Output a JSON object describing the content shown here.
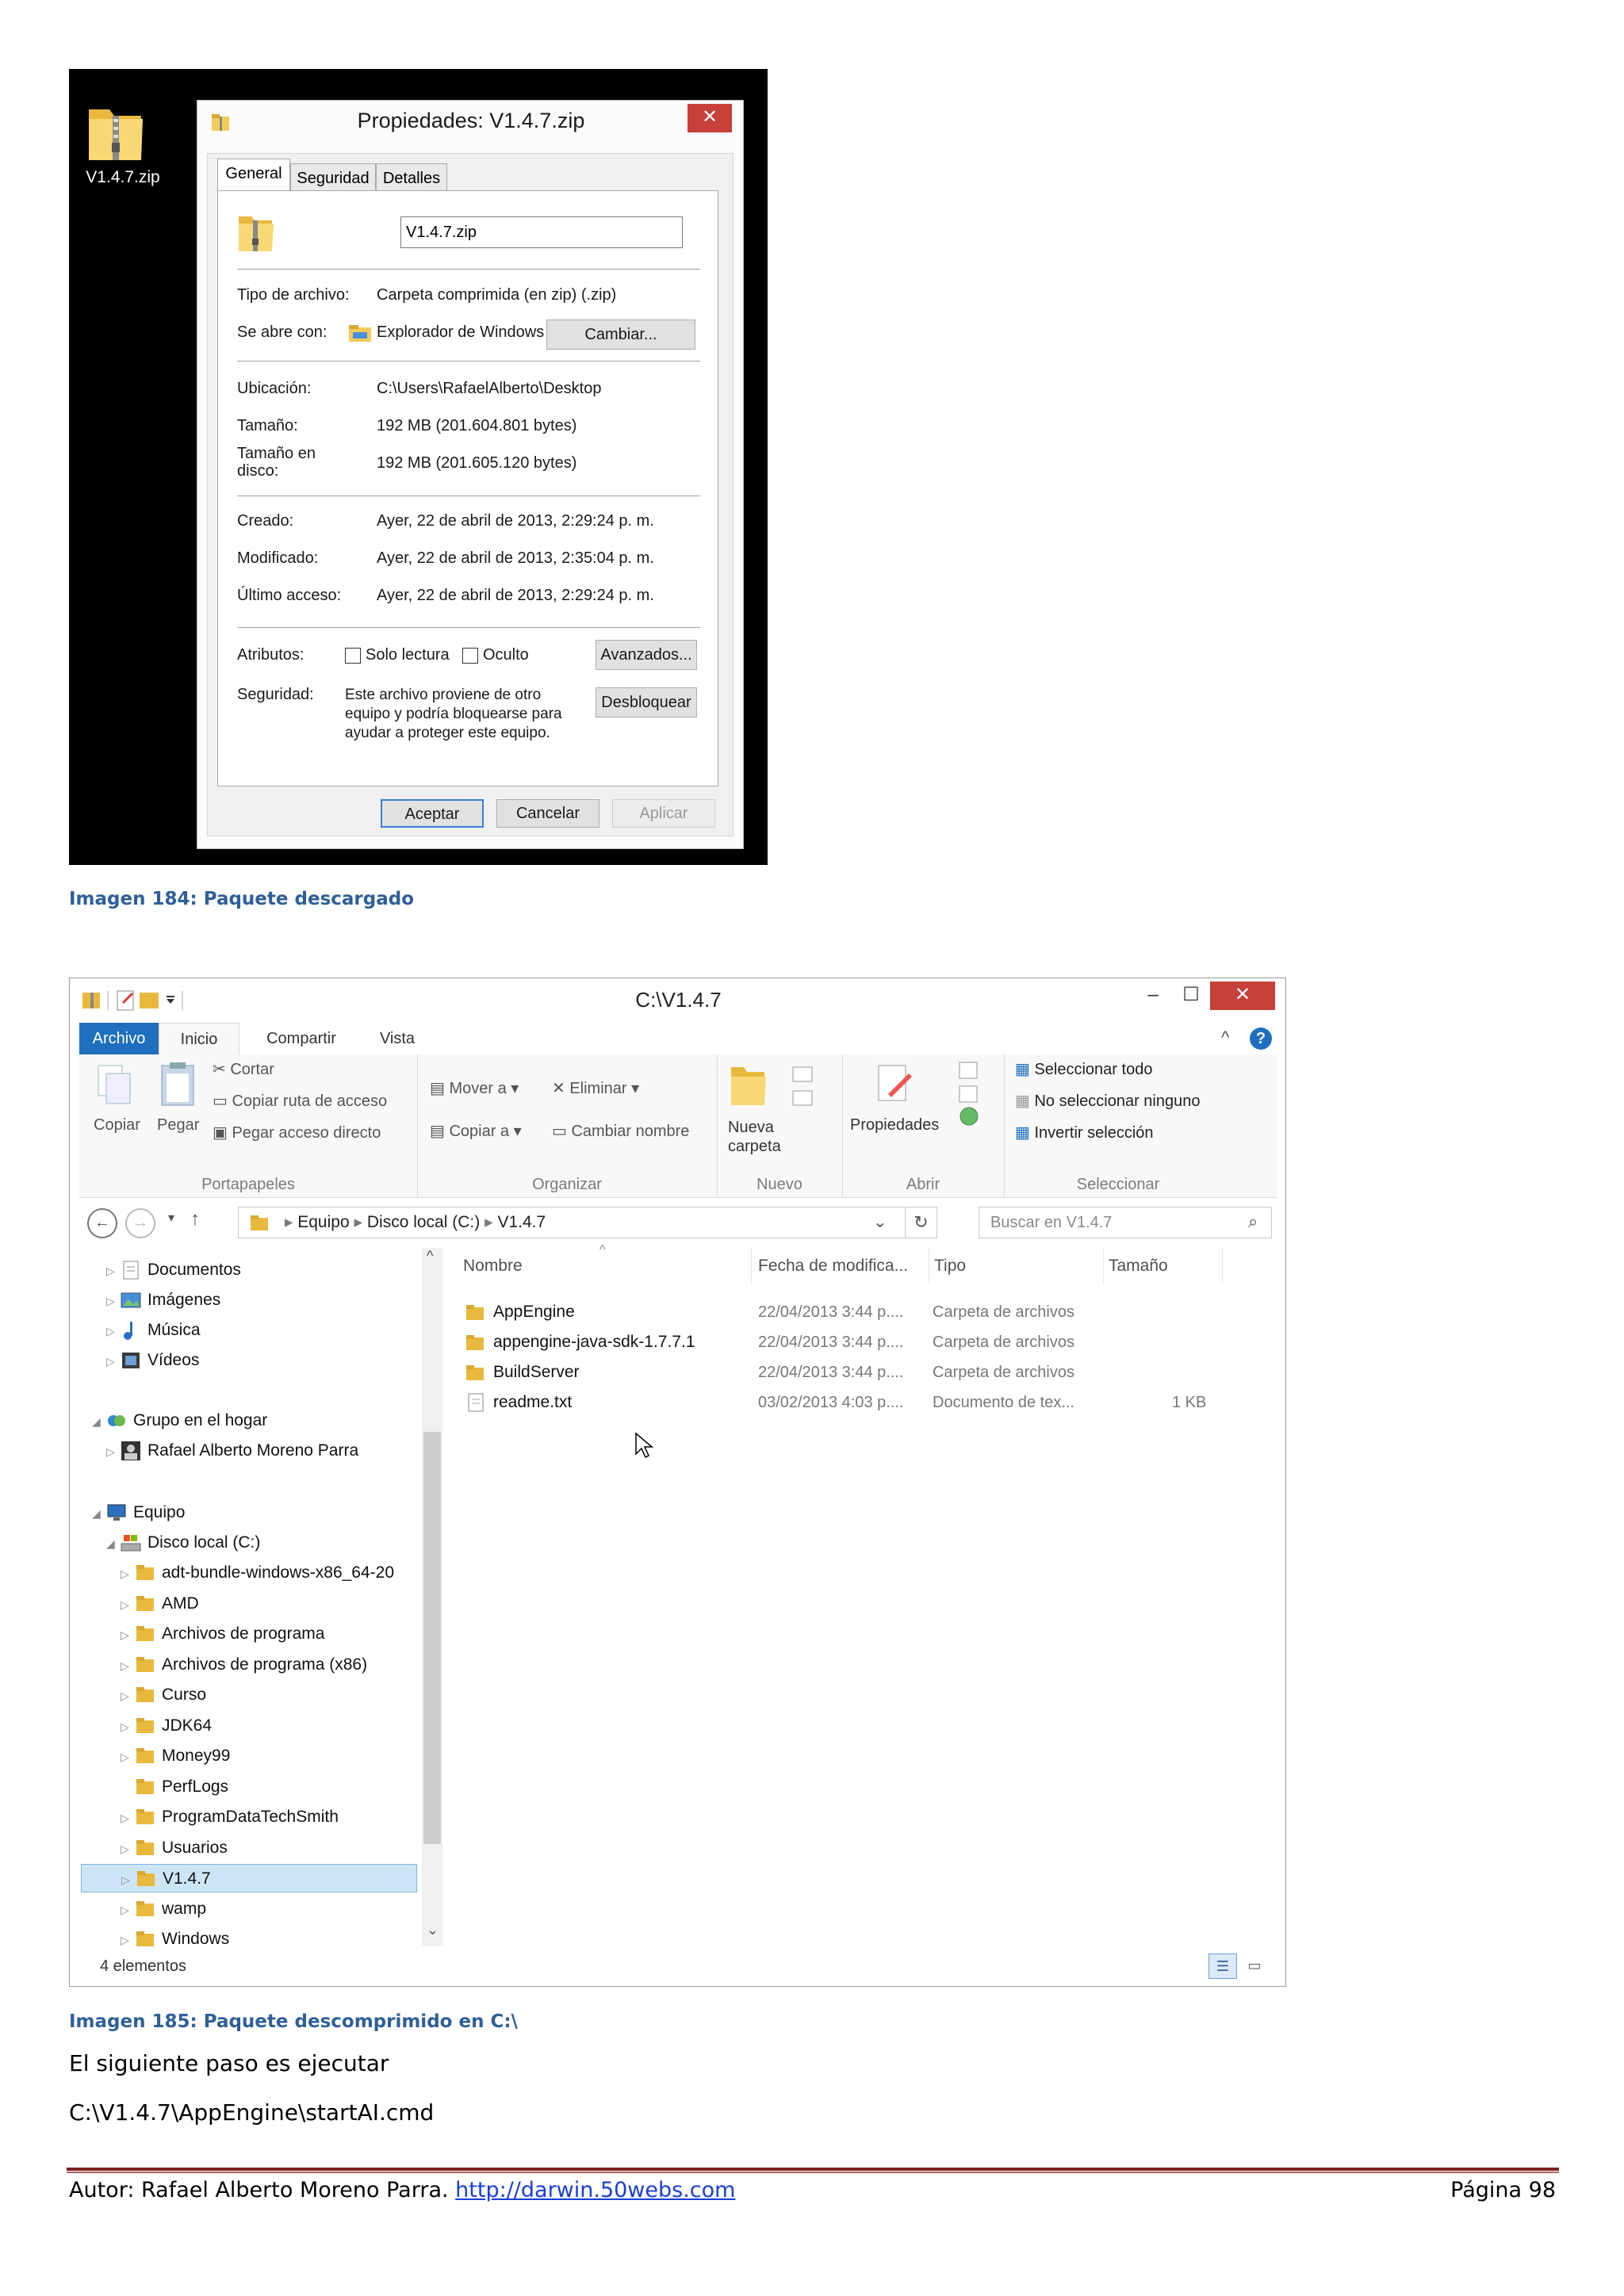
{
  "figure1": {
    "desktop_icon_label": "V1.4.7.zip",
    "dialog": {
      "title": "Propiedades: V1.4.7.zip",
      "close": "✕",
      "tabs": [
        "General",
        "Seguridad",
        "Detalles"
      ],
      "filename": "V1.4.7.zip",
      "tipo_label": "Tipo de archivo:",
      "tipo_value": "Carpeta comprimida (en zip) (.zip)",
      "abre_label": "Se abre con:",
      "abre_value": "Explorador de Windows",
      "cambiar": "Cambiar...",
      "ubicacion_label": "Ubicación:",
      "ubicacion_value": "C:\\Users\\RafaelAlberto\\Desktop",
      "tamano_label": "Tamaño:",
      "tamano_value": "192 MB (201.604.801 bytes)",
      "tamano_disco_label_1": "Tamaño en",
      "tamano_disco_label_2": "disco:",
      "tamano_disco_value": "192 MB (201.605.120 bytes)",
      "creado_label": "Creado:",
      "creado_value": "Ayer, 22 de abril de 2013, 2:29:24 p. m.",
      "modificado_label": "Modificado:",
      "modificado_value": "Ayer, 22 de abril de 2013, 2:35:04 p. m.",
      "acceso_label": "Último acceso:",
      "acceso_value": "Ayer, 22 de abril de 2013, 2:29:24 p. m.",
      "atributos_label": "Atributos:",
      "solo_lectura": "Solo lectura",
      "oculto": "Oculto",
      "avanzados": "Avanzados...",
      "seguridad_label": "Seguridad:",
      "seguridad_text_1": "Este archivo proviene de otro",
      "seguridad_text_2": "equipo y podría bloquearse para",
      "seguridad_text_3": "ayudar a proteger este equipo.",
      "desbloquear": "Desbloquear",
      "aceptar": "Aceptar",
      "cancelar": "Cancelar",
      "aplicar": "Aplicar"
    },
    "caption": "Imagen 184: Paquete descargado"
  },
  "figure2": {
    "window_title": "C:\\V1.4.7",
    "ribbon_tabs": [
      "Archivo",
      "Inicio",
      "Compartir",
      "Vista"
    ],
    "portapapeles": {
      "copiar": "Copiar",
      "pegar": "Pegar",
      "cortar": "Cortar",
      "copiar_ruta": "Copiar ruta de acceso",
      "pegar_acceso": "Pegar acceso directo",
      "name": "Portapapeles"
    },
    "organizar": {
      "mover": "Mover a",
      "copiar_a": "Copiar a",
      "eliminar": "Eliminar",
      "cambiar_nombre": "Cambiar nombre",
      "name": "Organizar"
    },
    "nuevo": {
      "nueva_1": "Nueva",
      "nueva_2": "carpeta",
      "name": "Nuevo"
    },
    "abrir": {
      "propiedades": "Propiedades",
      "name": "Abrir"
    },
    "seleccionar": {
      "todo": "Seleccionar todo",
      "ninguno": "No seleccionar ninguno",
      "invertir": "Invertir selección",
      "name": "Seleccionar"
    },
    "address": {
      "crumbs": [
        "Equipo",
        "Disco local (C:)",
        "V1.4.7"
      ]
    },
    "search_placeholder": "Buscar en V1.4.7",
    "nav": [
      {
        "label": "Documentos"
      },
      {
        "label": "Imágenes"
      },
      {
        "label": "Música"
      },
      {
        "label": "Vídeos"
      },
      {
        "label": "Grupo en el hogar"
      },
      {
        "label": "Rafael Alberto Moreno Parra"
      },
      {
        "label": "Equipo"
      },
      {
        "label": "Disco local (C:)"
      },
      {
        "label": "adt-bundle-windows-x86_64-20"
      },
      {
        "label": "AMD"
      },
      {
        "label": "Archivos de programa"
      },
      {
        "label": "Archivos de programa (x86)"
      },
      {
        "label": "Curso"
      },
      {
        "label": "JDK64"
      },
      {
        "label": "Money99"
      },
      {
        "label": "PerfLogs"
      },
      {
        "label": "ProgramDataTechSmith"
      },
      {
        "label": "Usuarios"
      },
      {
        "label": "V1.4.7"
      },
      {
        "label": "wamp"
      },
      {
        "label": "Windows"
      }
    ],
    "columns": [
      "Nombre",
      "Fecha de modifica...",
      "Tipo",
      "Tamaño"
    ],
    "files": [
      {
        "name": "AppEngine",
        "date": "22/04/2013 3:44 p....",
        "type": "Carpeta de archivos",
        "size": ""
      },
      {
        "name": "appengine-java-sdk-1.7.7.1",
        "date": "22/04/2013 3:44 p....",
        "type": "Carpeta de archivos",
        "size": ""
      },
      {
        "name": "BuildServer",
        "date": "22/04/2013 3:44 p....",
        "type": "Carpeta de archivos",
        "size": ""
      },
      {
        "name": "readme.txt",
        "date": "03/02/2013 4:03 p....",
        "type": "Documento de tex...",
        "size": "1 KB"
      }
    ],
    "status": "4 elementos",
    "caption": "Imagen 185: Paquete descomprimido en C:\\"
  },
  "body": {
    "line1": "El siguiente paso es ejecutar",
    "line2": "C:\\V1.4.7\\AppEngine\\startAI.cmd"
  },
  "footer": {
    "author": "Autor: Rafael Alberto Moreno Parra.",
    "link": "http://darwin.50webs.com",
    "page": "Página 98"
  }
}
